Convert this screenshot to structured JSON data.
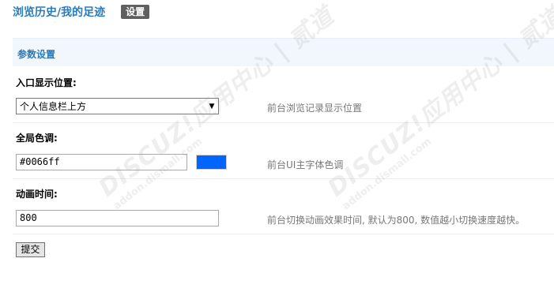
{
  "header": {
    "title": "浏览历史/我的足迹",
    "settings_tab": "设置"
  },
  "section": {
    "title": "参数设置"
  },
  "fields": {
    "entry_position": {
      "label": "入口显示位置:",
      "value": "个人信息栏上方",
      "help": "前台浏览记录显示位置"
    },
    "global_color": {
      "label": "全局色调:",
      "value": "#0066ff",
      "swatch_color": "#0066ff",
      "help": "前台UI主字体色调"
    },
    "animation_time": {
      "label": "动画时间:",
      "value": "800",
      "help": "前台切换动画效果时间, 默认为800, 数值越小切换速度越快。"
    }
  },
  "submit_label": "提交",
  "watermark": {
    "brand": "DISCUZ!应用中心 | 贰道",
    "url": "addon.dismall.com"
  }
}
